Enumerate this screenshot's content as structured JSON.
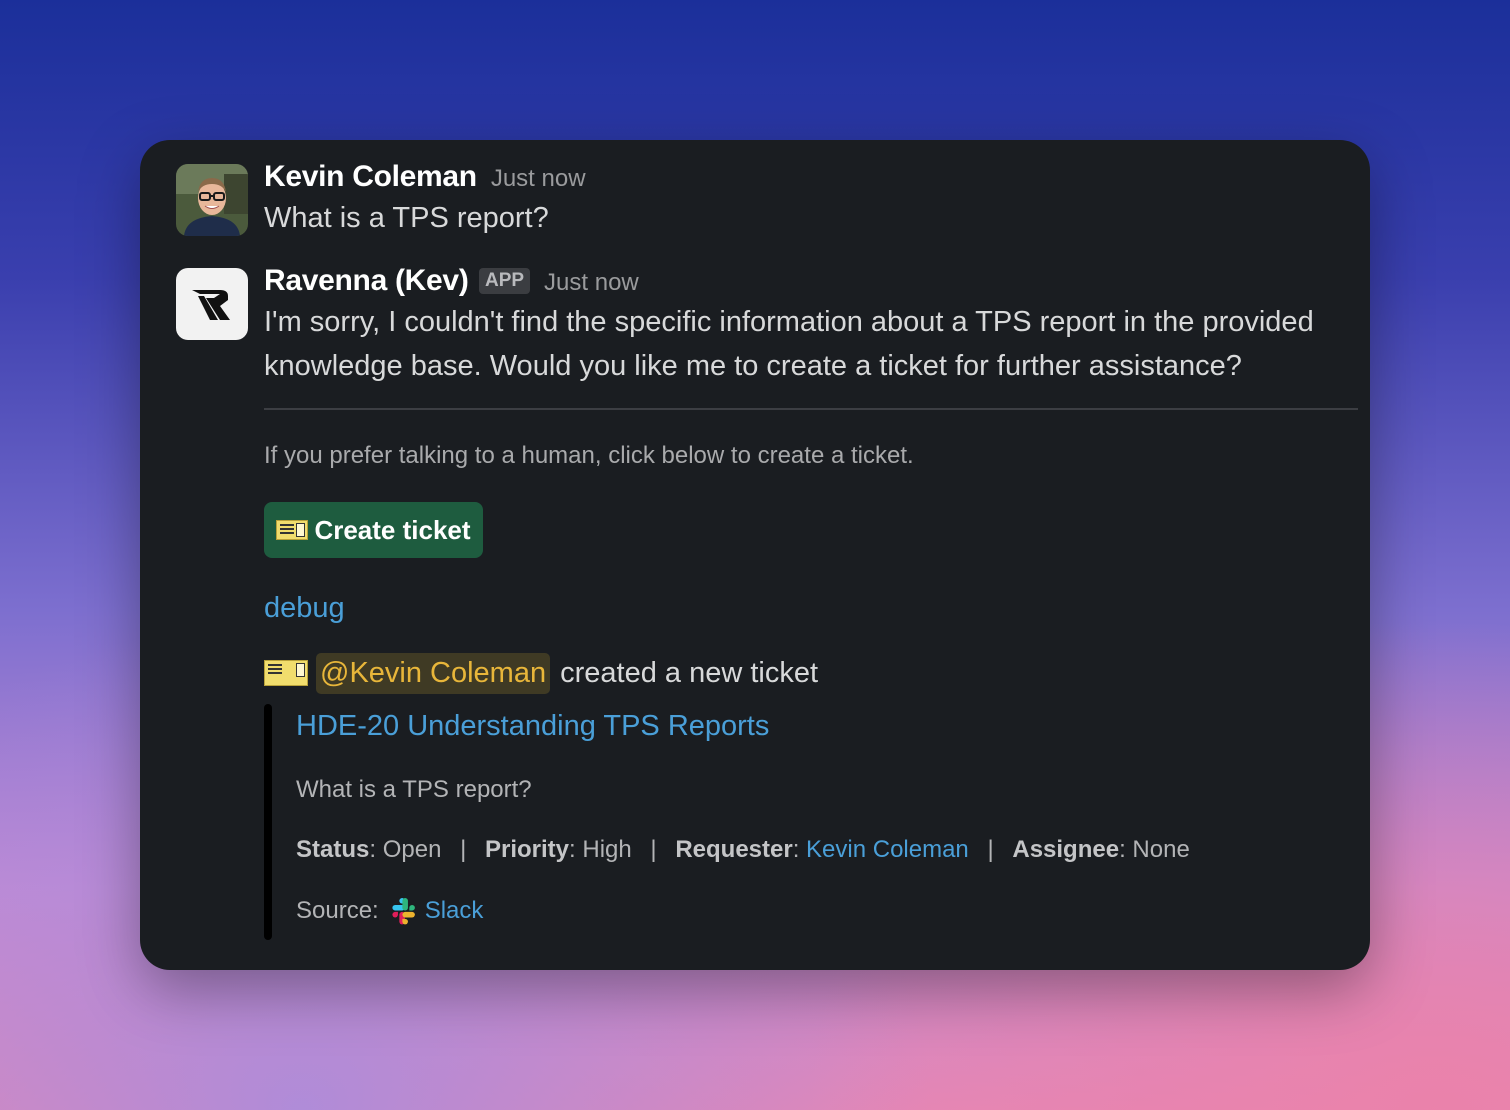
{
  "messages": [
    {
      "author": "Kevin Coleman",
      "timestamp": "Just now",
      "text": "What is a TPS report?"
    },
    {
      "author": "Ravenna (Kev)",
      "badge": "APP",
      "timestamp": "Just now",
      "text": "I'm sorry, I couldn't find the specific information about a TPS report in the provided knowledge base. Would you like me to create a ticket for further assistance?"
    }
  ],
  "hint": "If you prefer talking to a human, click below to create a ticket.",
  "create_button": {
    "icon": "ticket-icon",
    "label": "Create ticket"
  },
  "debug_label": "debug",
  "created": {
    "icon": "ticket-icon",
    "mention": "@Kevin Coleman",
    "text": "created a new ticket"
  },
  "ticket": {
    "title": "HDE-20 Understanding TPS Reports",
    "description": "What is a TPS report?",
    "fields": {
      "status_label": "Status",
      "status_value": "Open",
      "priority_label": "Priority",
      "priority_value": "High",
      "requester_label": "Requester",
      "requester_value": "Kevin Coleman",
      "assignee_label": "Assignee",
      "assignee_value": "None",
      "separator": "|"
    },
    "source_label": "Source:",
    "source_icon": "slack-icon",
    "source_value": "Slack"
  },
  "colors": {
    "card_bg": "#1a1d21",
    "link": "#4a9fd8",
    "mention": "#e8b63a",
    "button_bg": "#1e5c3f"
  }
}
